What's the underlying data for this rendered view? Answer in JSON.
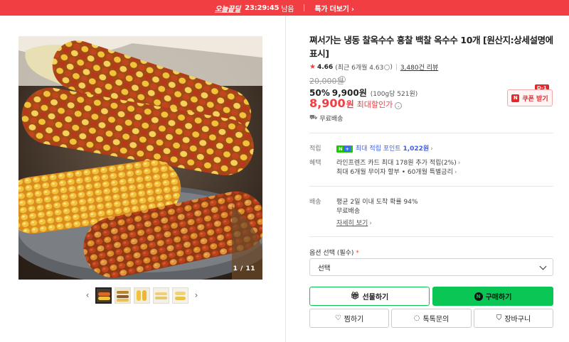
{
  "banner": {
    "brand": "오늘끝딜",
    "countdown": "23:29:45",
    "remaining_label": "남음",
    "more_label": "특가 더보기",
    "more_arrow": "›"
  },
  "gallery": {
    "counter": "1 / 11",
    "prev_arrow": "‹",
    "next_arrow": "›",
    "thumbnail_count": 5
  },
  "product": {
    "title": "쪄서가는 냉동 찰옥수수 흥찰 백찰 옥수수 10개 [원산지:상세설명에 표시]",
    "rating": {
      "score": "4.66",
      "recent": "(최근 6개월 4.63",
      "reviews": "3,480건 리뷰"
    },
    "original_price": "20,000원",
    "discount_pct": "50%",
    "sale_price": "9,900원",
    "unit_price": "(100g당 521원)",
    "best_price": "8,900",
    "best_won": "원",
    "best_label": "최대할인가",
    "coupon_label": "쿠폰 받기",
    "coupon_dday": "D-1",
    "shipping_free": "무료배송"
  },
  "benefits": {
    "point_label": "적립",
    "point_text": "최대 적립 포인트",
    "point_value": "1,022원",
    "benefit_label": "혜택",
    "benefit_line1": "라인프렌즈 카드 최대 178원 추가 적립(2%)",
    "benefit_line2": "최대 6개월 무이자 할부 • 60개월 특별금리"
  },
  "delivery": {
    "label": "배송",
    "line1": "평균 2일 이내 도착 확률 94%",
    "line2": "무료배송",
    "detail_link": "자세히 보기"
  },
  "option": {
    "label": "옵션 선택 (필수)",
    "required_mark": "*",
    "select_value": "선택"
  },
  "actions": {
    "gift": "선물하기",
    "buy": "구매하기",
    "zzim": "찜하기",
    "talk": "톡톡문의",
    "cart": "장바구니"
  },
  "colors": {
    "banner": "#f03e42",
    "naver_green": "#0ac755",
    "price_red": "#f03e42"
  }
}
